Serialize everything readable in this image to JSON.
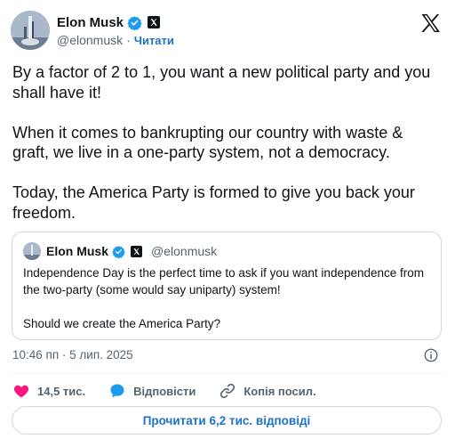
{
  "author": {
    "name": "Elon Musk",
    "handle": "@elonmusk",
    "separator": "·",
    "follow_label": "Читати"
  },
  "tweet": {
    "paragraphs": [
      "By a factor of 2 to 1, you want a new political party and you shall have it!",
      "When it comes to bankrupting our country with waste & graft, we live in a one-party system, not a democracy.",
      "Today, the America Party is formed to give you back your freedom."
    ]
  },
  "quote": {
    "name": "Elon Musk",
    "handle": "@elonmusk",
    "paragraphs": [
      "Independence Day is the perfect time to ask if you want independence from the two-party (some would say uniparty) system!",
      "Should we create the America Party?"
    ]
  },
  "timestamp": "10:46 пп · 5 лип. 2025",
  "actions": {
    "likes": "14,5 тис.",
    "reply": "Відповісти",
    "copy_link": "Копія посил."
  },
  "read_replies_label": "Прочитати 6,2 тис. відповіді",
  "colors": {
    "accent": "#1d72c8",
    "verified": "#1d9bf0",
    "like": "#f91880",
    "text": "#0f1419",
    "muted": "#536471",
    "border": "#cfd9de"
  }
}
